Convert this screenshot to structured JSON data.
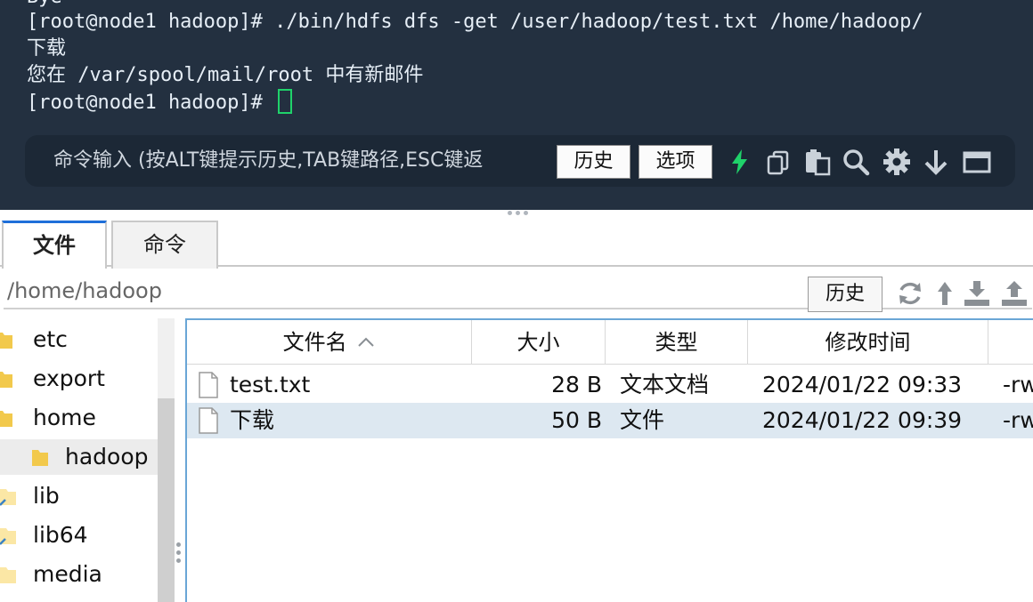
{
  "terminal": {
    "partial_line": "Bye",
    "lines": [
      "[root@node1 hadoop]# ./bin/hdfs dfs -get /user/hadoop/test.txt /home/hadoop/",
      "下载",
      "您在 /var/spool/mail/root 中有新邮件",
      "[root@node1 hadoop]# "
    ],
    "cmdbar": {
      "placeholder": "命令输入 (按ALT键提示历史,TAB键路径,ESC键返",
      "history_label": "历史",
      "options_label": "选项"
    },
    "icons": [
      "lightning-icon",
      "copy-icon",
      "paste-icon",
      "search-icon",
      "gear-icon",
      "arrow-down-icon",
      "window-icon"
    ],
    "accent": "#1fd26a",
    "background": "#233040"
  },
  "tabs": [
    {
      "label": "文件",
      "active": true
    },
    {
      "label": "命令",
      "active": false
    }
  ],
  "path": {
    "value": "/home/hadoop",
    "history_label": "历史",
    "icons": [
      "refresh-icon",
      "up-icon",
      "download-icon",
      "upload-icon"
    ]
  },
  "tree": {
    "items": [
      {
        "label": "etc",
        "indent": 0
      },
      {
        "label": "export",
        "indent": 0
      },
      {
        "label": "home",
        "indent": 0
      },
      {
        "label": "hadoop",
        "indent": 1,
        "selected": true
      },
      {
        "label": "lib",
        "indent": 0,
        "link": true
      },
      {
        "label": "lib64",
        "indent": 0,
        "link": true
      },
      {
        "label": "media",
        "indent": 0
      }
    ]
  },
  "files": {
    "columns": [
      "文件名",
      "大小",
      "类型",
      "修改时间",
      ""
    ],
    "rows": [
      {
        "name": "test.txt",
        "size": "28 B",
        "type": "文本文档",
        "modified": "2024/01/22 09:33",
        "perm": "-rw"
      },
      {
        "name": "下载",
        "size": "50 B",
        "type": "文件",
        "modified": "2024/01/22 09:39",
        "perm": "-rw",
        "selected": true
      }
    ]
  }
}
